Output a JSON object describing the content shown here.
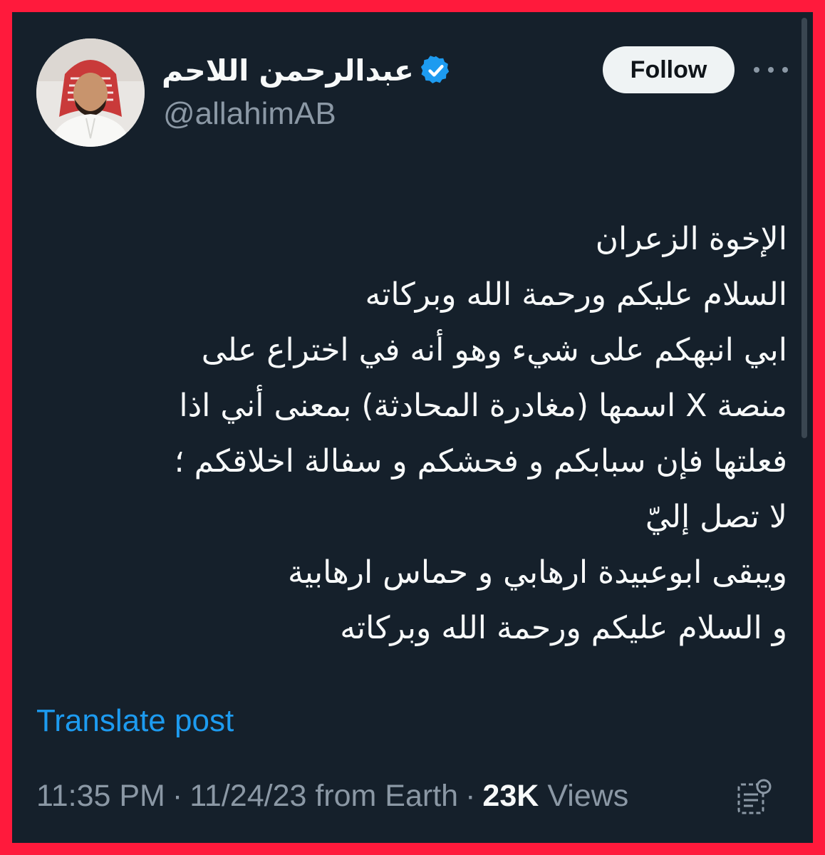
{
  "author": {
    "display_name": "عبدالرحمن اللاحم",
    "handle": "@allahimAB",
    "verified": true
  },
  "actions": {
    "follow_label": "Follow"
  },
  "post": {
    "lines": [
      "الإخوة الزعران",
      "السلام عليكم ورحمة الله وبركاته",
      "ابي انبهكم على شيء وهو أنه في اختراع على",
      "منصة X اسمها (مغادرة المحادثة) بمعنى أني اذا",
      "فعلتها فإن سبابكم و فحشكم و سفالة اخلاقكم ؛",
      "لا تصل إليّ",
      "ويبقى ابوعبيدة ارهابي و حماس ارهابية",
      "و السلام عليكم ورحمة الله وبركاته"
    ],
    "translate_label": "Translate post"
  },
  "meta": {
    "time": "11:35 PM",
    "separator": "·",
    "date": "11/24/23",
    "source": "from Earth",
    "views_count": "23K",
    "views_label": "Views"
  },
  "icons": {
    "verified": "verified-badge-icon",
    "more": "more-icon",
    "notes": "post-notes-icon"
  },
  "colors": {
    "background": "#15202b",
    "border": "#ff1a3c",
    "accent": "#1d9bf0",
    "text_primary": "#f7f9f9",
    "text_secondary": "#8b98a5",
    "follow_button_bg": "#eff3f4"
  }
}
